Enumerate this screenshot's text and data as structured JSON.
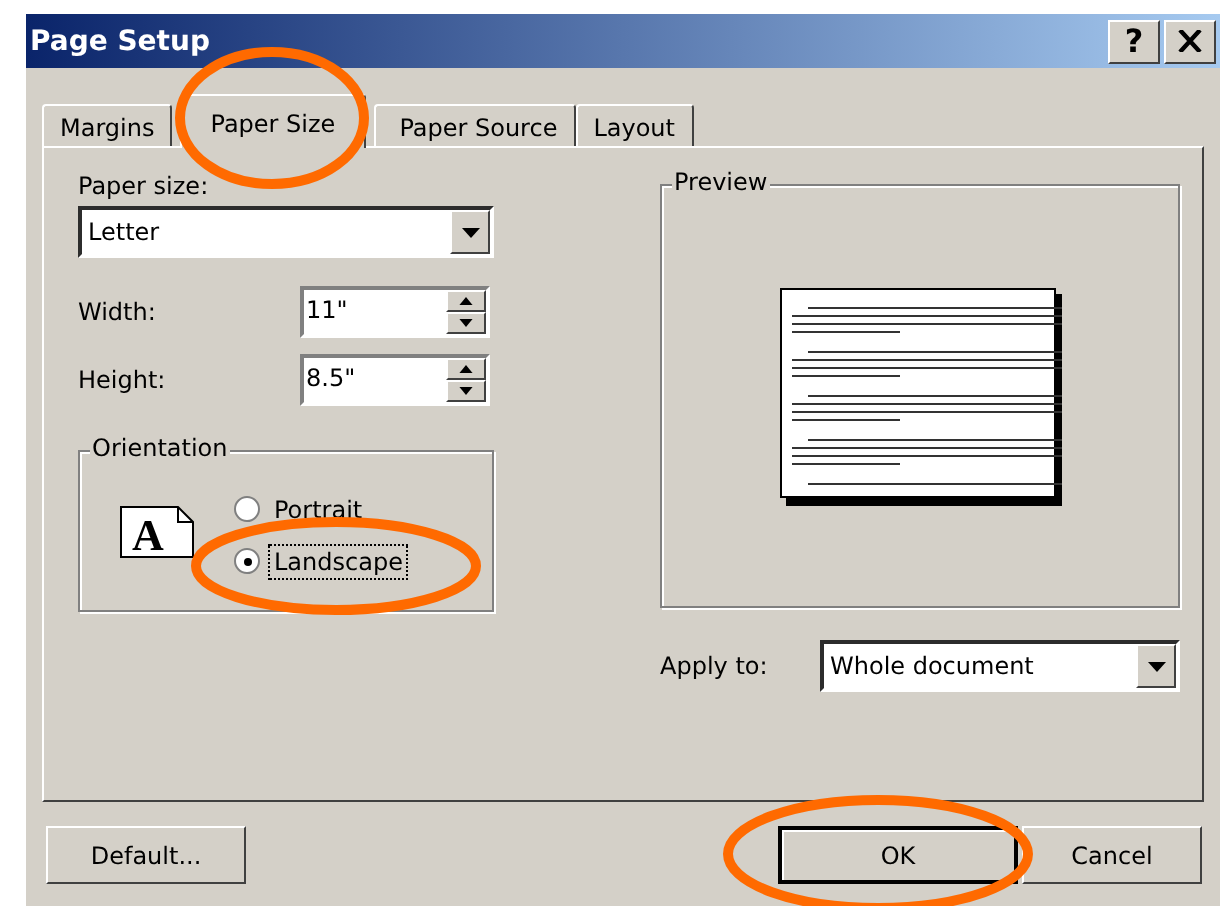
{
  "window": {
    "title": "Page Setup",
    "help_label": "?"
  },
  "tabs": [
    {
      "label": "Margins",
      "selected": false,
      "circled": false
    },
    {
      "label": "Paper Size",
      "selected": true,
      "circled": true
    },
    {
      "label": "Paper Source",
      "selected": false,
      "circled": false
    },
    {
      "label": "Layout",
      "selected": false,
      "circled": false
    }
  ],
  "paper_size": {
    "label": "Paper size:",
    "value": "Letter"
  },
  "width": {
    "label": "Width:",
    "value": "11\""
  },
  "height": {
    "label": "Height:",
    "value": "8.5\""
  },
  "orientation": {
    "title": "Orientation",
    "icon_letter": "A",
    "options": [
      {
        "label": "Portrait",
        "selected": false,
        "circled": false
      },
      {
        "label": "Landscape",
        "selected": true,
        "circled": true
      }
    ]
  },
  "preview": {
    "title": "Preview"
  },
  "apply_to": {
    "label": "Apply to:",
    "value": "Whole document"
  },
  "buttons": [
    {
      "label": "Default...",
      "kind": "left",
      "circled": false
    },
    {
      "label": "OK",
      "kind": "default",
      "circled": true
    },
    {
      "label": "Cancel",
      "kind": "right",
      "circled": false
    }
  ]
}
